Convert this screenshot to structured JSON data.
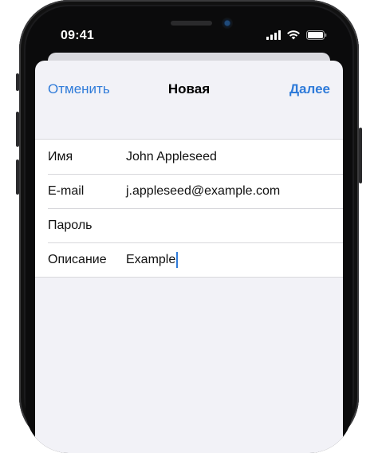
{
  "status_bar": {
    "time": "09:41",
    "icons": [
      "signal-icon",
      "wifi-icon",
      "battery-icon"
    ]
  },
  "nav": {
    "cancel_label": "Отменить",
    "title": "Новая",
    "next_label": "Далее"
  },
  "form": {
    "rows": [
      {
        "label": "Имя",
        "value": "John Appleseed"
      },
      {
        "label": "E-mail",
        "value": "j.appleseed@example.com"
      },
      {
        "label": "Пароль",
        "value": ""
      },
      {
        "label": "Описание",
        "value": "Example"
      }
    ]
  },
  "colors": {
    "accent": "#2f7bd9",
    "sheet_background": "#f2f2f7",
    "frame": "#1b1b1d"
  }
}
